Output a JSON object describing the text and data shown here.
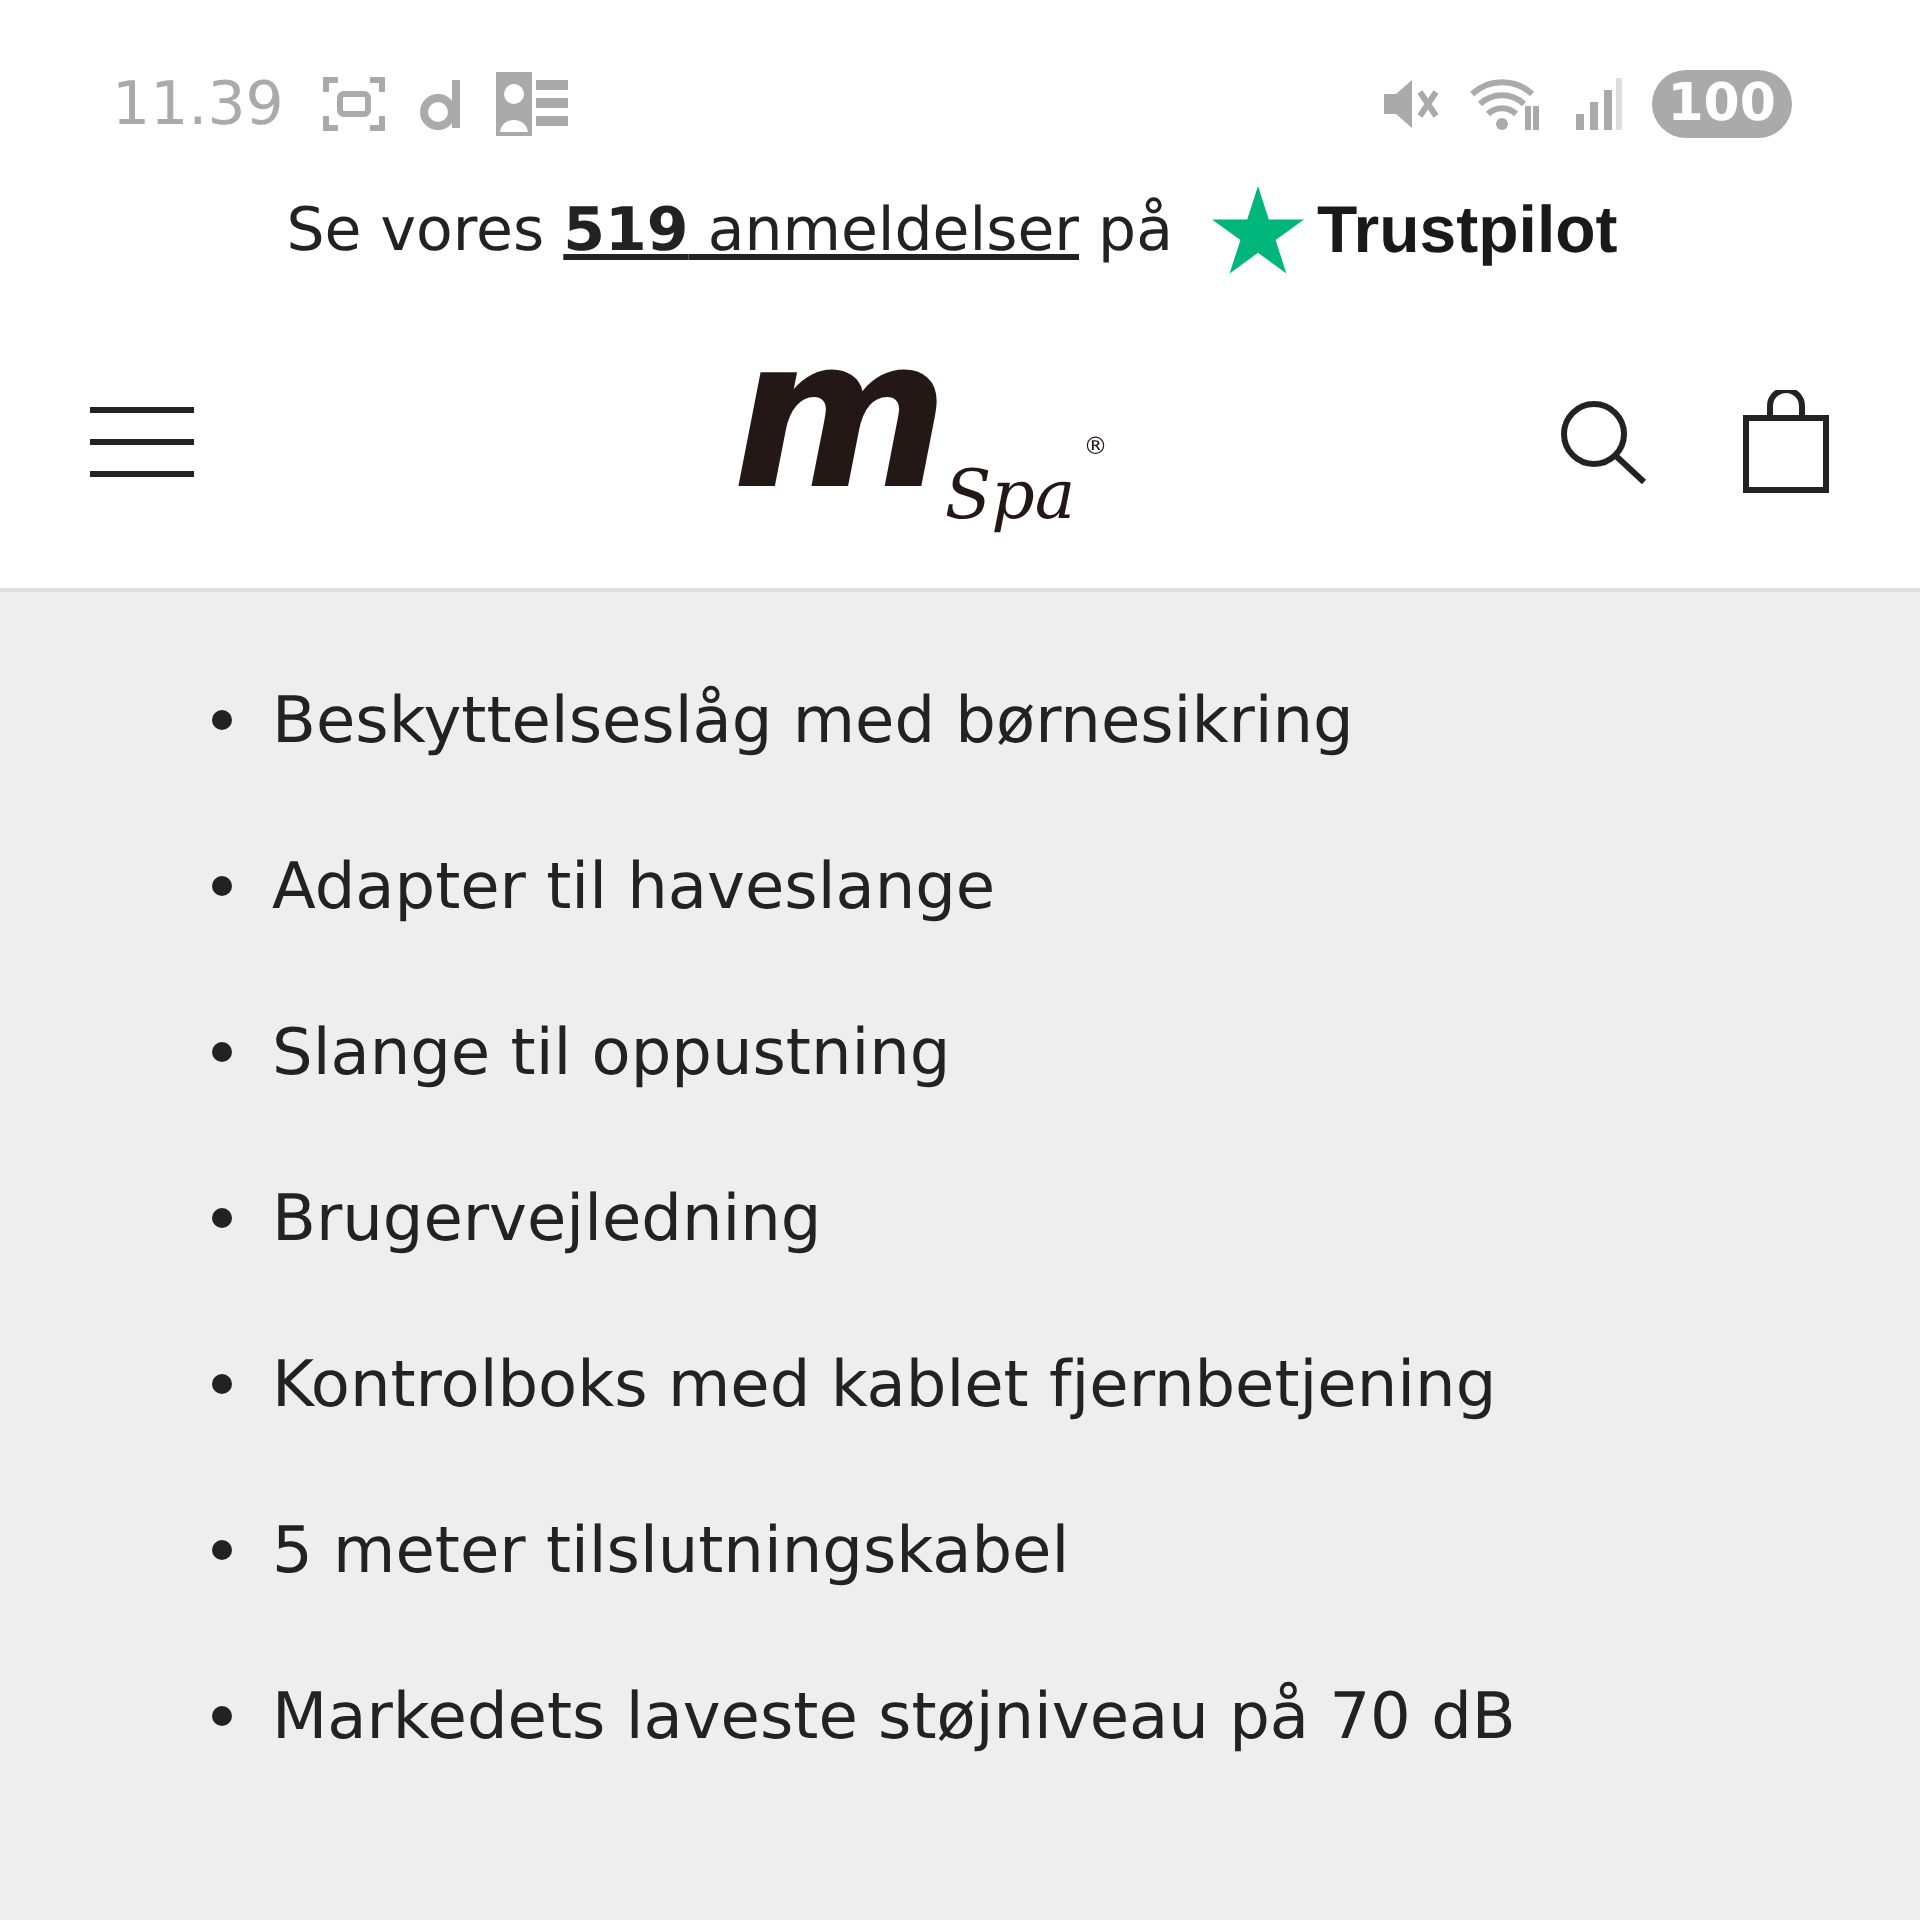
{
  "status_bar": {
    "time": "11.39",
    "battery": "100"
  },
  "review_banner": {
    "prefix": "Se vores ",
    "link": "**519** anmeldelser",
    "suffix": " på",
    "brand": "Trustpilot"
  },
  "header": {
    "logo": {
      "mark": "m",
      "word": "Spa",
      "registered": "®"
    }
  },
  "features": [
    {
      "text": "Beskyttelseslåg med børnesikring"
    },
    {
      "text": "Adapter til haveslange"
    },
    {
      "text": "Slange til oppustning"
    },
    {
      "text": "Brugervejledning"
    },
    {
      "text": "Kontrolboks med kablet fjernbetjening"
    },
    {
      "text": "5 meter tilslutningskabel"
    },
    {
      "text": "Markedets laveste støjniveau på 70 dB"
    }
  ]
}
